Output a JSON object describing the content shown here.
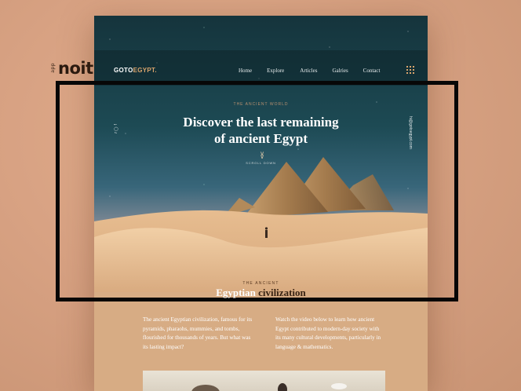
{
  "studio": {
    "small": "app",
    "big": "noit"
  },
  "site": {
    "brand_main": "GOTO",
    "brand_accent": "EGYPT.",
    "nav": [
      "Home",
      "Explore",
      "Articles",
      "Galries",
      "Contact"
    ],
    "hero": {
      "eyebrow": "THE ANCIENT WORLD",
      "headline_line1": "Discover the last remaining",
      "headline_line2": "of ancient Egypt",
      "scroll_label": "SCROLL DOWN",
      "side_email": "hi@gotoegypt.com",
      "social_icons": [
        "facebook-icon",
        "instagram-icon",
        "twitter-icon"
      ]
    },
    "section": {
      "eyebrow": "THE ANCIENT",
      "title_word1": "Egyptian",
      "title_word2": "civilization",
      "col_left": "The ancient Egyptian civilization, famous for its pyramids, pharaohs, mummies, and tombs, flourished for thousands of years. But what was its lasting impact?",
      "col_right": "Watch the video below to learn how ancient Egypt contributed to modern-day society with its many cultural developments, particularly in language & mathematics."
    }
  },
  "colors": {
    "accent": "#d9a46c",
    "frame": "#070707",
    "sand": "#d7ac84",
    "sky": "#15343c"
  }
}
